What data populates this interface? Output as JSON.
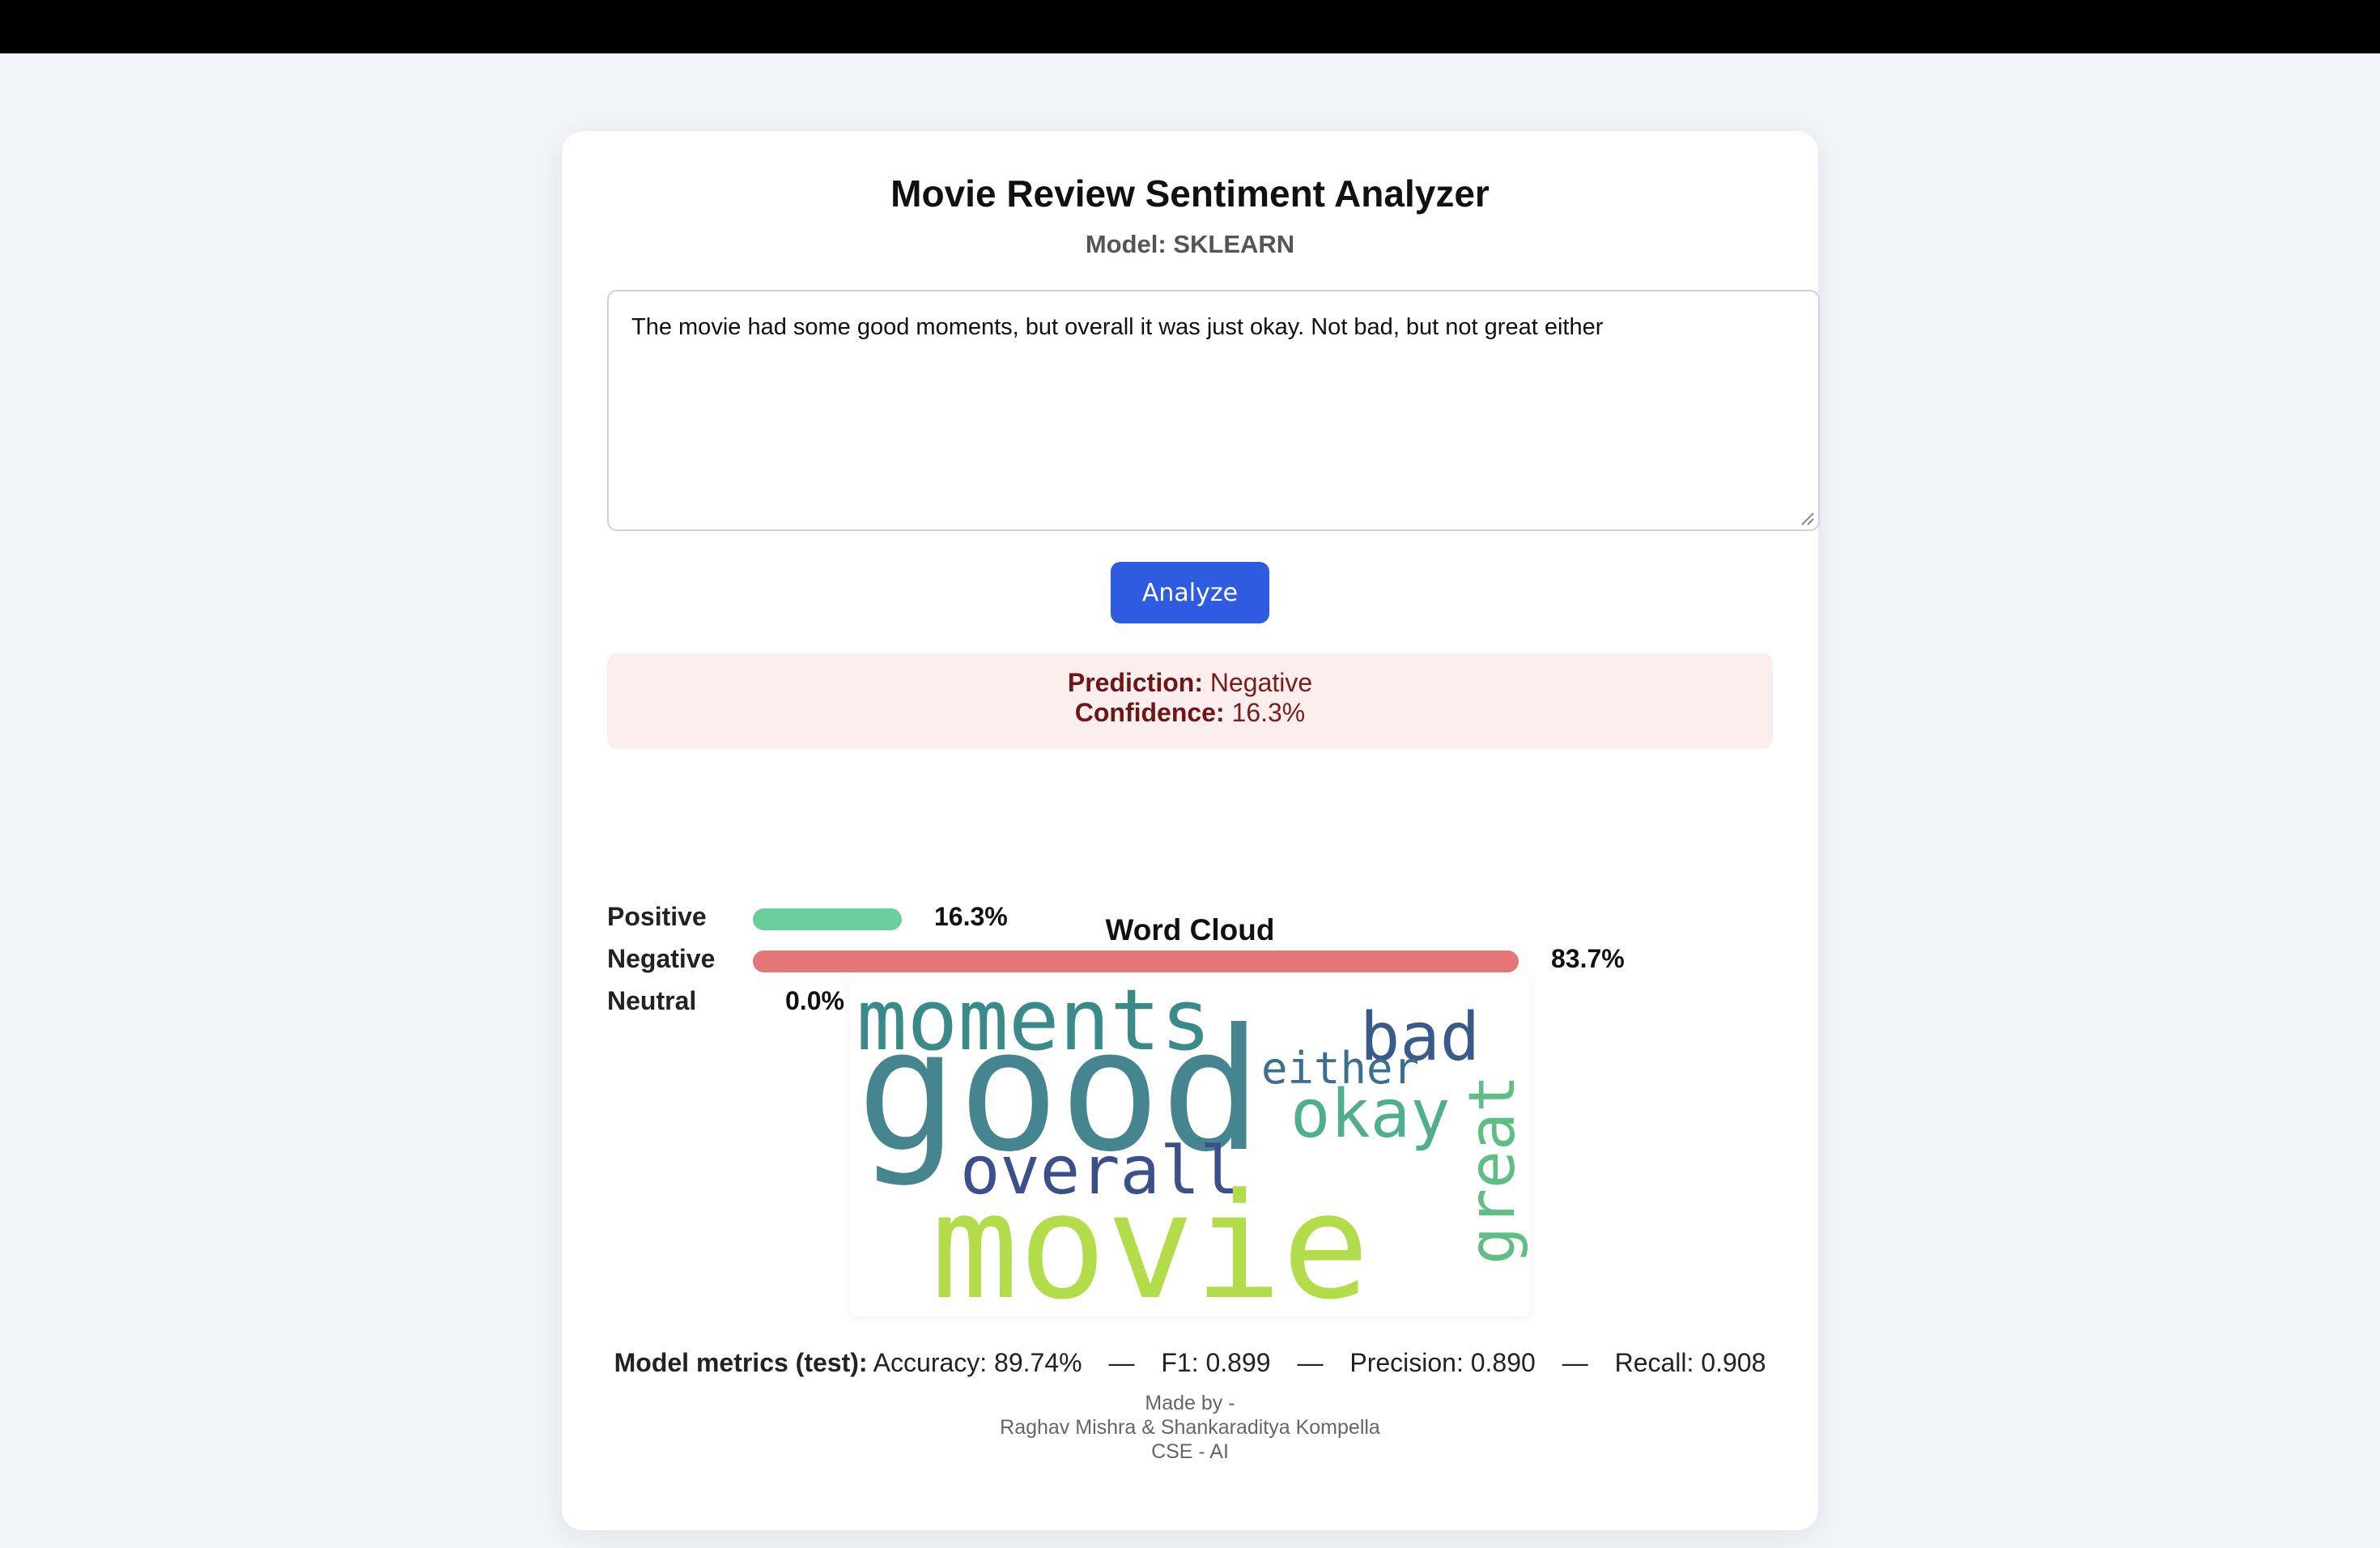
{
  "app": {
    "title": "Movie Review Sentiment Analyzer",
    "model_label": "Model: SKLEARN"
  },
  "input": {
    "review_text": "The movie had some good moments, but overall it was just okay. Not bad, but not great either"
  },
  "actions": {
    "analyze_label": "Analyze"
  },
  "result": {
    "prediction_label": "Prediction:",
    "prediction_value": "Negative",
    "confidence_label": "Confidence:",
    "confidence_value": "16.3%"
  },
  "scores": [
    {
      "label": "Positive",
      "value_text": "16.3%",
      "fraction": 0.163,
      "color": "#6acf9c"
    },
    {
      "label": "Negative",
      "value_text": "83.7%",
      "fraction": 0.837,
      "color": "#e57676"
    },
    {
      "label": "Neutral",
      "value_text": "0.0%",
      "fraction": 0.0,
      "color": "#cccccc"
    }
  ],
  "wordcloud": {
    "title": "Word Cloud",
    "words": [
      {
        "text": "moments",
        "color": "#3a8a8a"
      },
      {
        "text": "good",
        "color": "#44858f"
      },
      {
        "text": "bad",
        "color": "#3b5a8c"
      },
      {
        "text": "either",
        "color": "#3b6e8f"
      },
      {
        "text": "okay",
        "color": "#4fae90"
      },
      {
        "text": "overall",
        "color": "#3b4f8a"
      },
      {
        "text": "movie",
        "color": "#b3dc4a"
      },
      {
        "text": "great",
        "color": "#5fbe84"
      }
    ]
  },
  "metrics": {
    "label": "Model metrics (test):",
    "accuracy": "Accuracy: 89.74%",
    "f1": "F1: 0.899",
    "precision": "Precision: 0.890",
    "recall": "Recall: 0.908",
    "separator": "—"
  },
  "footer": {
    "line1": "Made by -",
    "line2": "Raghav Mishra & Shankaraditya Kompella",
    "line3": "CSE - AI"
  }
}
